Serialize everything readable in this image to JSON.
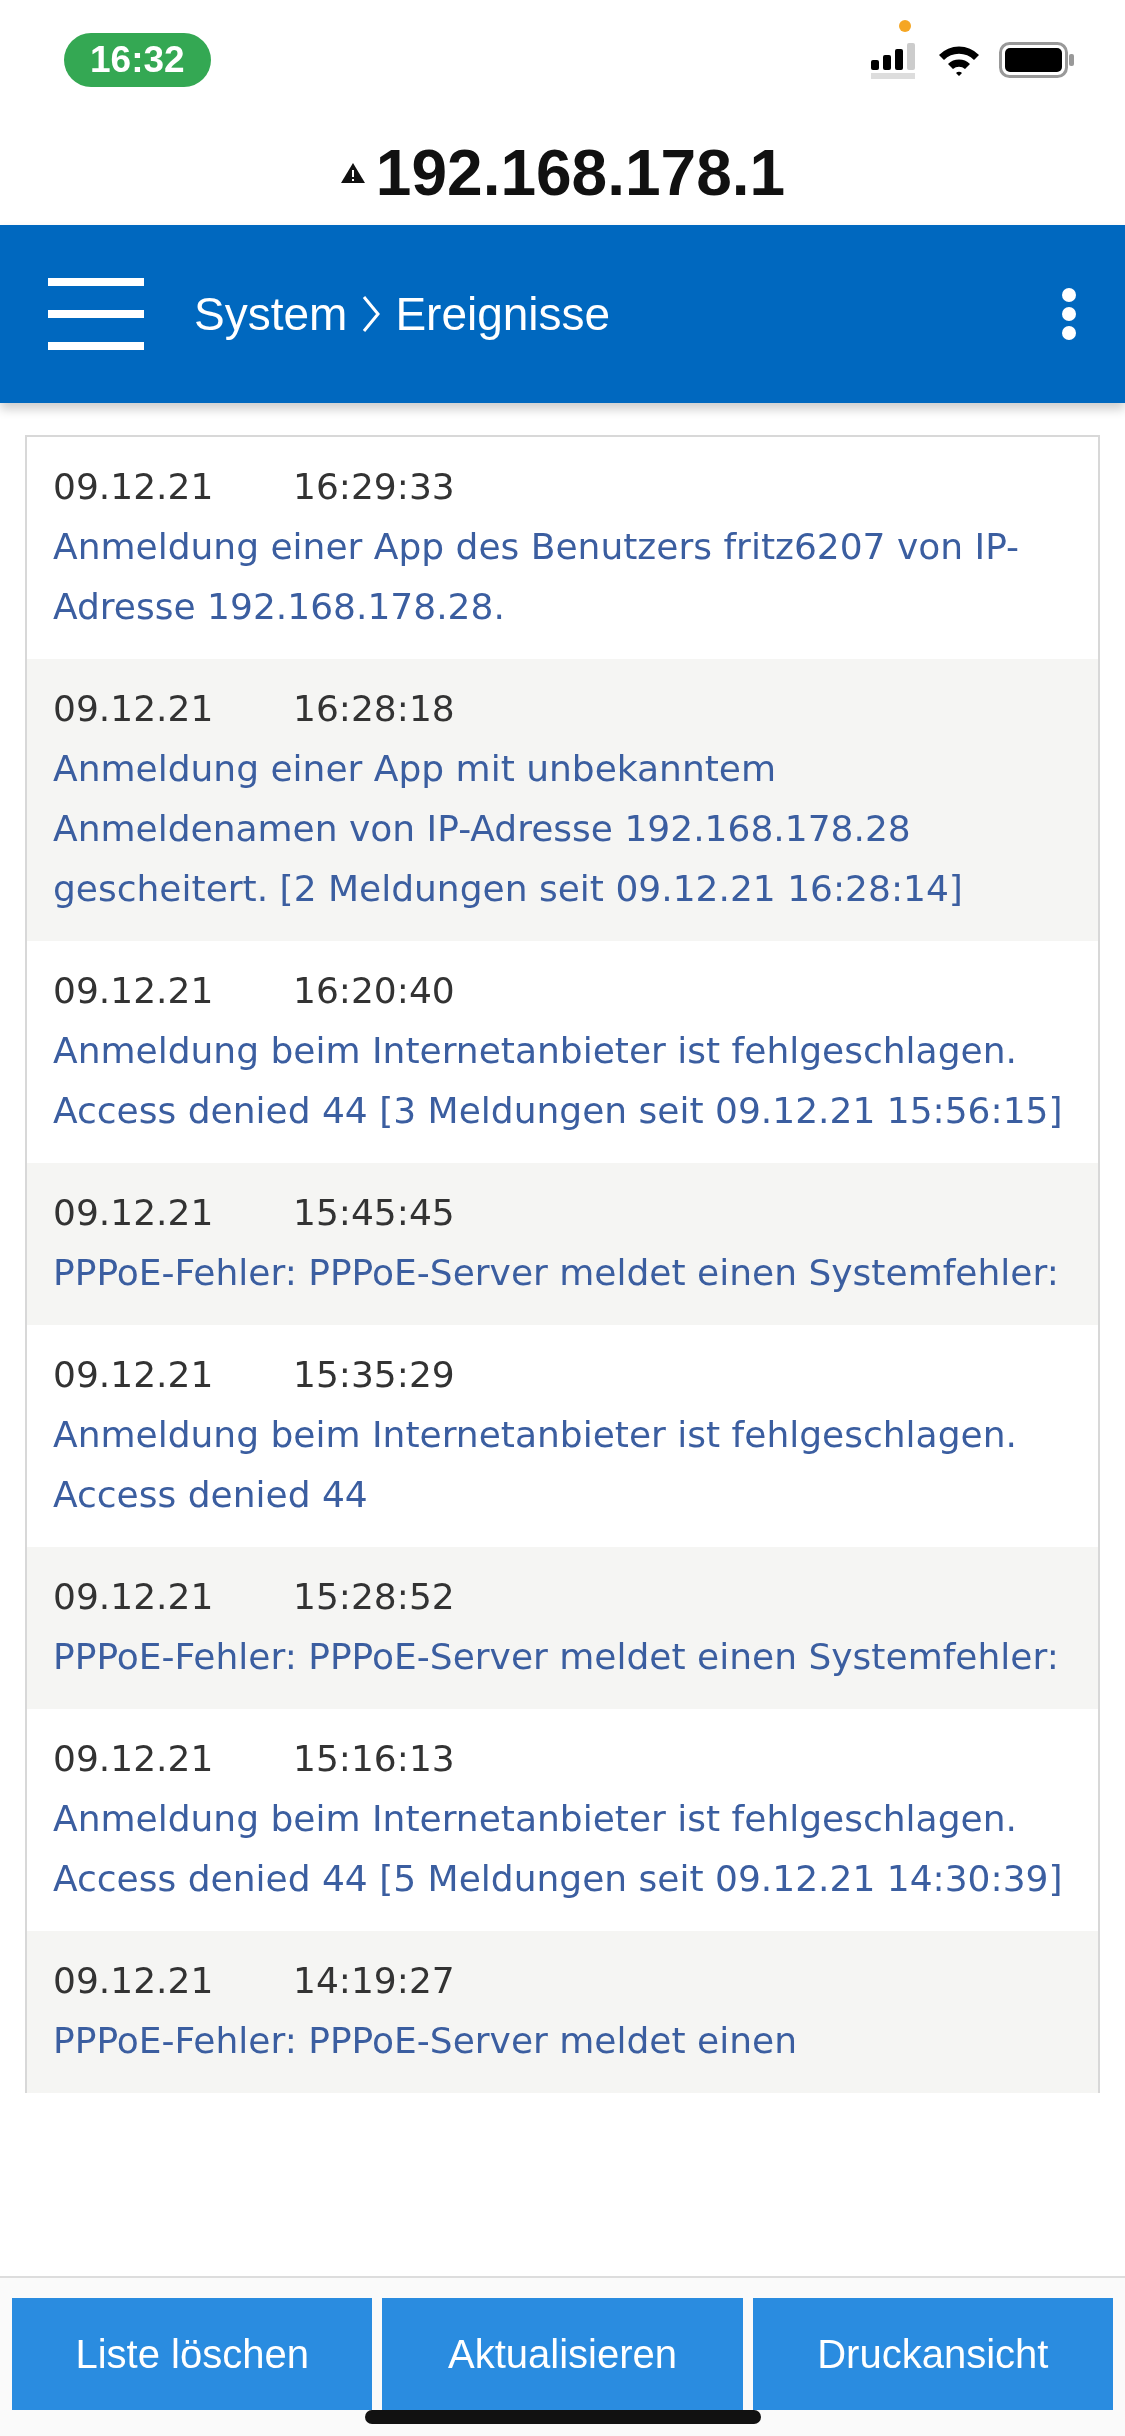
{
  "status_bar": {
    "time": "16:32"
  },
  "address_bar": {
    "url": "192.168.178.1"
  },
  "header": {
    "breadcrumb": [
      "System",
      "Ereignisse"
    ]
  },
  "events": [
    {
      "date": "09.12.21",
      "time": "16:29:33",
      "message": "Anmeldung einer App des Benutzers fritz6207 von IP-Adresse 192.168.178.28."
    },
    {
      "date": "09.12.21",
      "time": "16:28:18",
      "message": "Anmeldung einer App mit unbekanntem Anmeldenamen von IP-Adresse 192.168.178.28 gescheitert. [2 Meldungen seit 09.12.21 16:28:14]"
    },
    {
      "date": "09.12.21",
      "time": "16:20:40",
      "message": "Anmeldung beim Internetanbieter ist fehlgeschlagen. Access denied 44 [3 Meldungen seit 09.12.21 15:56:15]"
    },
    {
      "date": "09.12.21",
      "time": "15:45:45",
      "message": "PPPoE-Fehler: PPPoE-Server meldet einen Systemfehler:"
    },
    {
      "date": "09.12.21",
      "time": "15:35:29",
      "message": "Anmeldung beim Internetanbieter ist fehlgeschlagen. Access denied 44"
    },
    {
      "date": "09.12.21",
      "time": "15:28:52",
      "message": "PPPoE-Fehler: PPPoE-Server meldet einen Systemfehler:"
    },
    {
      "date": "09.12.21",
      "time": "15:16:13",
      "message": "Anmeldung beim Internetanbieter ist fehlgeschlagen. Access denied 44 [5 Meldungen seit 09.12.21 14:30:39]"
    },
    {
      "date": "09.12.21",
      "time": "14:19:27",
      "message": "PPPoE-Fehler: PPPoE-Server meldet einen"
    }
  ],
  "buttons": [
    "Liste löschen",
    "Aktualisieren",
    "Druckansicht"
  ]
}
